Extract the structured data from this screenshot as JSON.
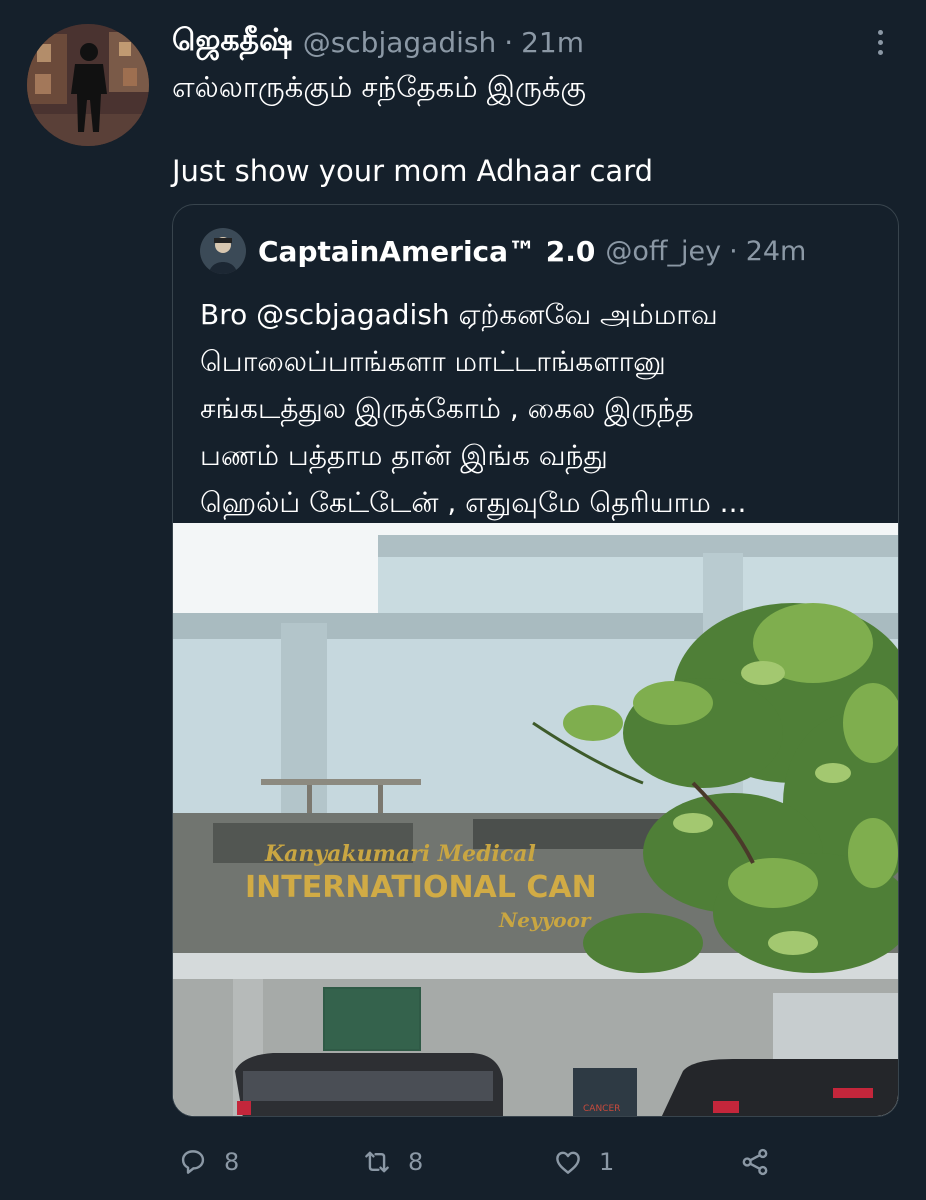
{
  "tweet": {
    "author": {
      "display_name": "ஜெகதீஷ்",
      "handle": "@scbjagadish",
      "time": "21m",
      "avatar_icon": "avatar-person-silhouette"
    },
    "text_line1": "எல்லாருக்கும் சந்தேகம் இருக்கு",
    "text_line2": "Just show your mom Adhaar card",
    "separator": "·"
  },
  "quoted": {
    "author": {
      "display_name": "CaptainAmerica™ 2.0",
      "handle": "@off_jey",
      "time": "24m"
    },
    "text_lines": [
      "Bro @scbjagadish ஏற்கனவே அம்மாவ",
      "பொலைப்பாங்களா மாட்டாங்களானு",
      "சங்கடத்துல இருக்கோம் , கைல இருந்த",
      "பணம் பத்தாம தான் இங்க வந்து",
      "ஹெல்ப் கேட்டேன் , எதுவுமே தெரியாம ..."
    ],
    "image": {
      "sign_line1": "Kanyakumari Medical",
      "sign_line2": "INTERNATIONAL CAN",
      "sign_line3": "Neyyoor",
      "door_sign": "CANCER"
    }
  },
  "actions": {
    "reply_count": "8",
    "retweet_count": "8",
    "like_count": "1"
  },
  "colors": {
    "background": "#15202b",
    "secondary_text": "#8b98a5",
    "border": "#38444d"
  }
}
